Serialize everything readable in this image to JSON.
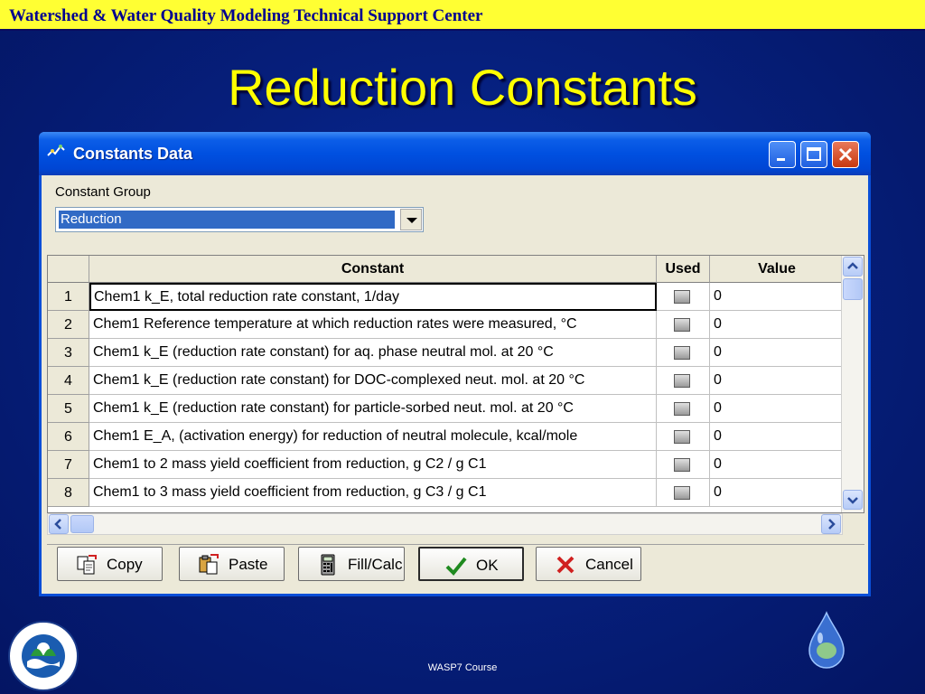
{
  "banner": {
    "text": "Watershed & Water Quality Modeling Technical Support Center"
  },
  "slide": {
    "title": "Reduction Constants",
    "footer": "WASP7 Course"
  },
  "window": {
    "title": "Constants Data",
    "group_label": "Constant Group",
    "group_value": "Reduction"
  },
  "grid": {
    "headers": {
      "constant": "Constant",
      "used": "Used",
      "value": "Value"
    },
    "rows": [
      {
        "num": "1",
        "constant": "Chem1 k_E, total reduction rate constant, 1/day",
        "value": "0"
      },
      {
        "num": "2",
        "constant": "Chem1 Reference temperature at which reduction rates were measured, °C",
        "value": "0"
      },
      {
        "num": "3",
        "constant": "Chem1 k_E (reduction rate constant) for aq. phase neutral mol. at 20 °C",
        "value": "0"
      },
      {
        "num": "4",
        "constant": "Chem1 k_E (reduction rate constant) for DOC-complexed neut. mol. at 20 °C",
        "value": "0"
      },
      {
        "num": "5",
        "constant": "Chem1 k_E (reduction rate constant) for particle-sorbed neut. mol. at 20 °C",
        "value": "0"
      },
      {
        "num": "6",
        "constant": "Chem1 E_A, (activation energy) for reduction of neutral molecule, kcal/mole",
        "value": "0"
      },
      {
        "num": "7",
        "constant": "Chem1 to 2 mass yield coefficient from reduction, g C2 / g C1",
        "value": "0"
      },
      {
        "num": "8",
        "constant": "Chem1 to 3 mass yield coefficient from reduction, g C3 / g C1",
        "value": "0"
      }
    ]
  },
  "buttons": {
    "copy": "Copy",
    "paste": "Paste",
    "fill_calc": "Fill/Calc",
    "ok": "OK",
    "cancel": "Cancel"
  },
  "colors": {
    "slide_bg": "#06207e",
    "banner": "#ffff33",
    "title": "#ffff00",
    "window_frame": "#0a4fd8"
  }
}
